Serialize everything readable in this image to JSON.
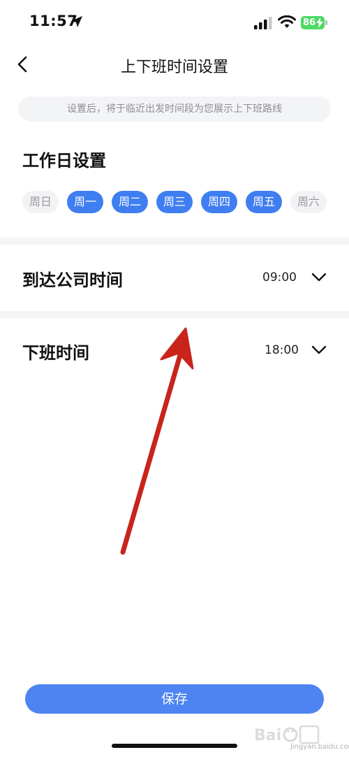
{
  "status_bar": {
    "time": "11:57",
    "battery": "86"
  },
  "nav": {
    "title": "上下班时间设置"
  },
  "hint": "设置后，将于临近出发时间段为您展示上下班路线",
  "workday": {
    "title": "工作日设置",
    "days": [
      {
        "label": "周日",
        "selected": false
      },
      {
        "label": "周一",
        "selected": true
      },
      {
        "label": "周二",
        "selected": true
      },
      {
        "label": "周三",
        "selected": true
      },
      {
        "label": "周四",
        "selected": true
      },
      {
        "label": "周五",
        "selected": true
      },
      {
        "label": "周六",
        "selected": false
      }
    ]
  },
  "arrive": {
    "label": "到达公司时间",
    "value": "09:00"
  },
  "leave": {
    "label": "下班时间",
    "value": "18:00"
  },
  "save_label": "保存",
  "watermark": {
    "text": "jingyan.baidu.com"
  },
  "colors": {
    "accent": "#3f7ef0",
    "save_button": "#4d84f1",
    "arrow": "#c8241c",
    "battery": "#4cd964"
  }
}
